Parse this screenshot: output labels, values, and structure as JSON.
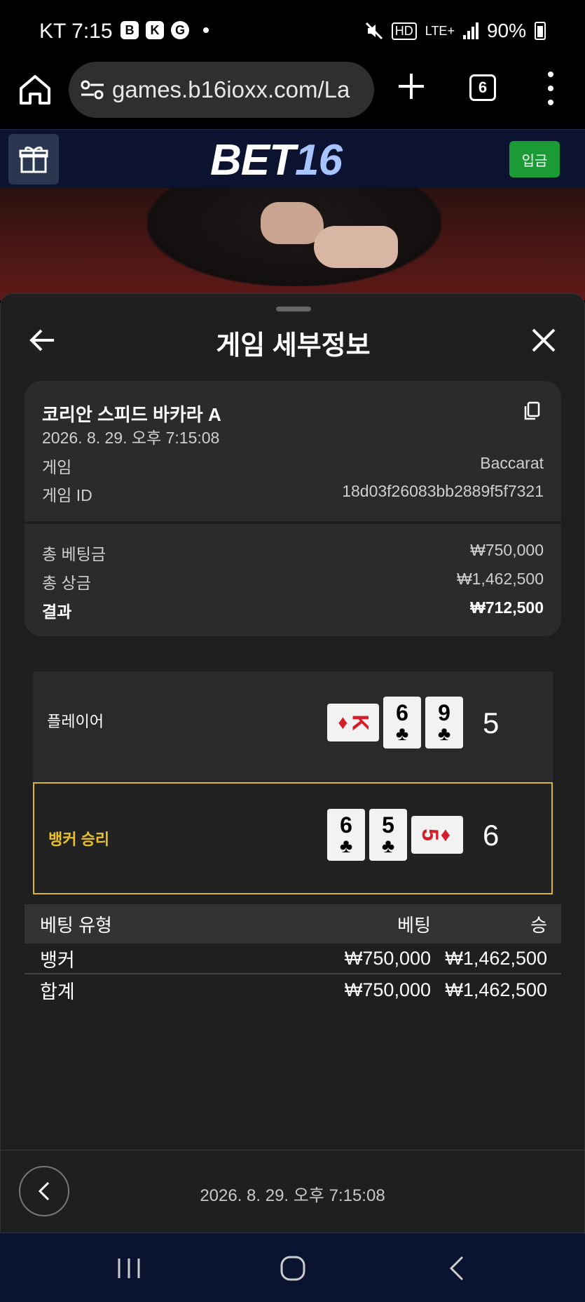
{
  "status_bar": {
    "carrier_time": "KT 7:15",
    "left_icons": [
      "B",
      "K",
      "G"
    ],
    "network": "LTE+",
    "hd": "HD",
    "battery": "90%"
  },
  "browser": {
    "url": "games.b16ioxx.com/La",
    "tab_count": "6"
  },
  "site": {
    "logo_part1": "BET",
    "logo_part2": "16",
    "deposit_label": "입금"
  },
  "sheet": {
    "title": "게임 세부정보",
    "game_name": "코리안 스피드 바카라 A",
    "game_datetime": "2026. 8. 29. 오후 7:15:08",
    "game_label": "게임",
    "game_value": "Baccarat",
    "game_id_label": "게임 ID",
    "game_id_value": "18d03f26083bb2889f5f7321",
    "total_bet_label": "총 베팅금",
    "total_bet_value": "₩750,000",
    "total_prize_label": "총 상금",
    "total_prize_value": "₩1,462,500",
    "result_label": "결과",
    "result_value": "₩712,500"
  },
  "hands": {
    "player": {
      "label": "플레이어",
      "score": "5",
      "cards": [
        {
          "rank": "K",
          "suit": "♦",
          "color": "red",
          "orientation": "horizontal"
        },
        {
          "rank": "6",
          "suit": "♣",
          "color": "black",
          "orientation": "vertical"
        },
        {
          "rank": "9",
          "suit": "♣",
          "color": "black",
          "orientation": "vertical"
        }
      ]
    },
    "banker": {
      "label": "뱅커 승리",
      "score": "6",
      "cards": [
        {
          "rank": "6",
          "suit": "♣",
          "color": "black",
          "orientation": "vertical"
        },
        {
          "rank": "5",
          "suit": "♣",
          "color": "black",
          "orientation": "vertical"
        },
        {
          "rank": "5",
          "suit": "♦",
          "color": "red",
          "orientation": "horizontal"
        }
      ]
    }
  },
  "bet_table": {
    "headers": [
      "베팅 유형",
      "베팅",
      "승"
    ],
    "rows": [
      [
        "뱅커",
        "₩750,000",
        "₩1,462,500"
      ],
      [
        "합계",
        "₩750,000",
        "₩1,462,500"
      ]
    ]
  },
  "footer": {
    "datetime": "2026. 8. 29. 오후 7:15:08"
  },
  "colors": {
    "accent_gold": "#d8b62e",
    "deposit_green": "#1a9b35",
    "header_navy": "#0b1330"
  }
}
